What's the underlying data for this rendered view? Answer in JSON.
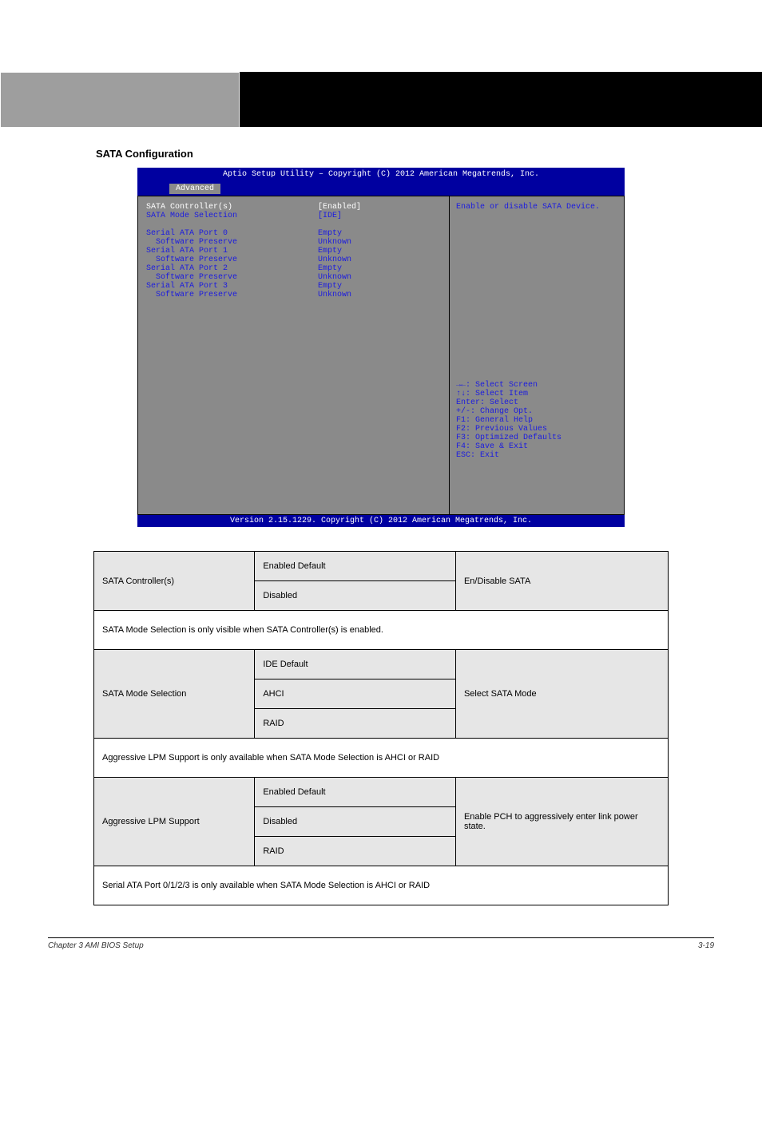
{
  "header": {
    "left": "",
    "right": ""
  },
  "section_title": "SATA Configuration",
  "bios": {
    "title": "Aptio Setup Utility – Copyright (C) 2012 American Megatrends, Inc.",
    "tab": "Advanced",
    "help": "Enable or disable SATA Device.",
    "footer": "Version 2.15.1229. Copyright (C) 2012 American Megatrends, Inc.",
    "settings": {
      "sata_controller_label": "SATA Controller(s)",
      "sata_controller_value": "[Enabled]",
      "sata_mode_label": "SATA Mode Selection",
      "sata_mode_value": "[IDE]"
    },
    "ports": [
      {
        "label": "Serial ATA Port 0",
        "value": "Empty",
        "sw_label": "Software Preserve",
        "sw_value": "Unknown"
      },
      {
        "label": "Serial ATA Port 1",
        "value": "Empty",
        "sw_label": "Software Preserve",
        "sw_value": "Unknown"
      },
      {
        "label": "Serial ATA Port 2",
        "value": "Empty",
        "sw_label": "Software Preserve",
        "sw_value": "Unknown"
      },
      {
        "label": "Serial ATA Port 3",
        "value": "Empty",
        "sw_label": "Software Preserve",
        "sw_value": "Unknown"
      }
    ],
    "keys": [
      "→←: Select Screen",
      "↑↓: Select Item",
      "Enter: Select",
      "+/-: Change Opt.",
      "F1: General Help",
      "F2: Previous Values",
      "F3: Optimized Defaults",
      "F4: Save & Exit",
      "ESC: Exit"
    ]
  },
  "table": {
    "row1": {
      "name": "SATA Controller(s)",
      "opt1": "Enabled          Default",
      "opt2": "Disabled",
      "desc": "En/Disable SATA"
    },
    "note1": "SATA Mode Selection is only visible when SATA Controller(s) is enabled.",
    "row2": {
      "name": "SATA Mode Selection",
      "opt1": "IDE                 Default",
      "opt2": "AHCI",
      "opt3": "RAID",
      "desc": "Select SATA Mode"
    },
    "note2": "Aggressive LPM Support is only available when SATA Mode Selection is AHCI or RAID",
    "row3": {
      "name": "Aggressive LPM Support",
      "opt1": "Enabled                 Default",
      "opt2": "Disabled",
      "opt3": "RAID",
      "desc": "Enable PCH to aggressively enter link power state."
    },
    "note3": "Serial ATA Port 0/1/2/3 is only available when SATA Mode Selection is AHCI or RAID"
  },
  "footer": {
    "left": "Chapter 3 AMI BIOS Setup",
    "right": "3-19"
  }
}
